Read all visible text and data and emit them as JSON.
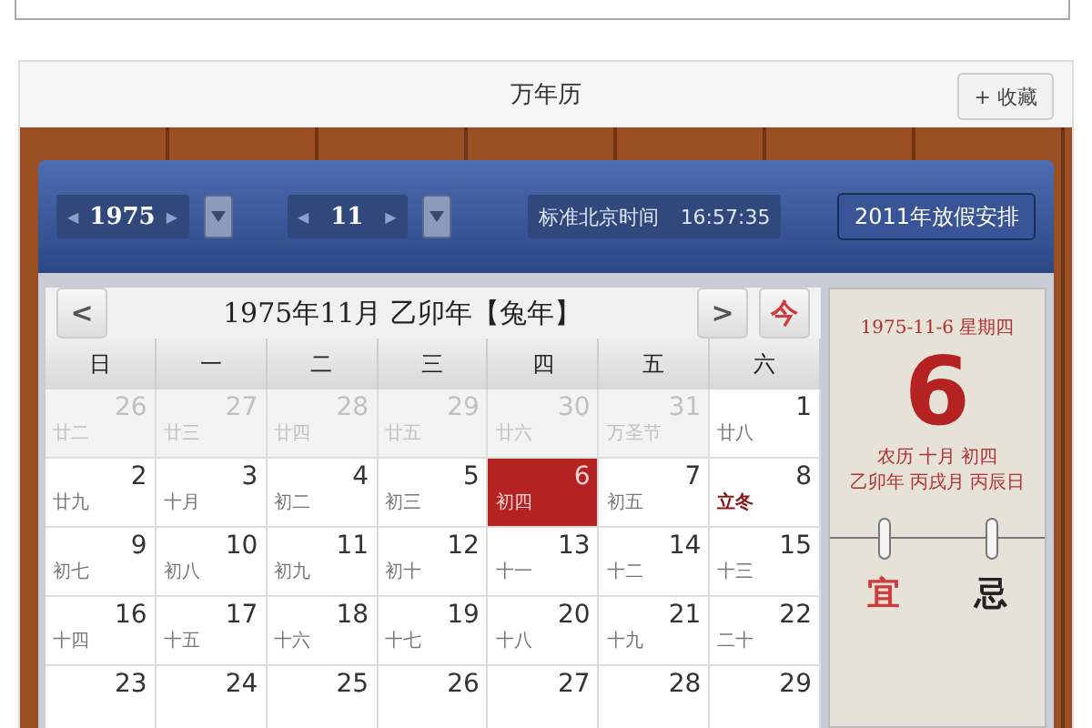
{
  "header": {
    "title": "万年历",
    "bookmark_button": "+ 收藏"
  },
  "toolbar": {
    "year": {
      "value": "1975",
      "prev": "◀",
      "next": "▶"
    },
    "month": {
      "value": "11",
      "prev": "◀",
      "next": "▶"
    },
    "clock_label": "标准北京时间",
    "clock_time": "16:57:35",
    "holiday_button": "2011年放假安排"
  },
  "calendar": {
    "prev_button": "<",
    "next_button": ">",
    "today_button": "今",
    "month_title": "1975年11月 乙卯年【兔年】",
    "weekdays": [
      "日",
      "一",
      "二",
      "三",
      "四",
      "五",
      "六"
    ],
    "weeks": [
      [
        {
          "day": "26",
          "lunar": "廿二",
          "kind": "other",
          "selected": false
        },
        {
          "day": "27",
          "lunar": "廿三",
          "kind": "other",
          "selected": false
        },
        {
          "day": "28",
          "lunar": "廿四",
          "kind": "other",
          "selected": false
        },
        {
          "day": "29",
          "lunar": "廿五",
          "kind": "other",
          "selected": false
        },
        {
          "day": "30",
          "lunar": "廿六",
          "kind": "other",
          "selected": false
        },
        {
          "day": "31",
          "lunar": "万圣节",
          "kind": "other",
          "selected": false
        },
        {
          "day": "1",
          "lunar": "廿八",
          "kind": "normal",
          "selected": false
        }
      ],
      [
        {
          "day": "2",
          "lunar": "廿九",
          "kind": "normal",
          "selected": false
        },
        {
          "day": "3",
          "lunar": "十月",
          "kind": "normal",
          "selected": false
        },
        {
          "day": "4",
          "lunar": "初二",
          "kind": "normal",
          "selected": false
        },
        {
          "day": "5",
          "lunar": "初三",
          "kind": "normal",
          "selected": false
        },
        {
          "day": "6",
          "lunar": "初四",
          "kind": "normal",
          "selected": true
        },
        {
          "day": "7",
          "lunar": "初五",
          "kind": "normal",
          "selected": false
        },
        {
          "day": "8",
          "lunar": "立冬",
          "kind": "term",
          "selected": false
        }
      ],
      [
        {
          "day": "9",
          "lunar": "初七",
          "kind": "normal",
          "selected": false
        },
        {
          "day": "10",
          "lunar": "初八",
          "kind": "normal",
          "selected": false
        },
        {
          "day": "11",
          "lunar": "初九",
          "kind": "normal",
          "selected": false
        },
        {
          "day": "12",
          "lunar": "初十",
          "kind": "normal",
          "selected": false
        },
        {
          "day": "13",
          "lunar": "十一",
          "kind": "normal",
          "selected": false
        },
        {
          "day": "14",
          "lunar": "十二",
          "kind": "normal",
          "selected": false
        },
        {
          "day": "15",
          "lunar": "十三",
          "kind": "normal",
          "selected": false
        }
      ],
      [
        {
          "day": "16",
          "lunar": "十四",
          "kind": "normal",
          "selected": false
        },
        {
          "day": "17",
          "lunar": "十五",
          "kind": "normal",
          "selected": false
        },
        {
          "day": "18",
          "lunar": "十六",
          "kind": "normal",
          "selected": false
        },
        {
          "day": "19",
          "lunar": "十七",
          "kind": "normal",
          "selected": false
        },
        {
          "day": "20",
          "lunar": "十八",
          "kind": "normal",
          "selected": false
        },
        {
          "day": "21",
          "lunar": "十九",
          "kind": "normal",
          "selected": false
        },
        {
          "day": "22",
          "lunar": "二十",
          "kind": "normal",
          "selected": false
        }
      ],
      [
        {
          "day": "23",
          "kind": "normal",
          "selected": false
        },
        {
          "day": "24",
          "kind": "normal",
          "selected": false
        },
        {
          "day": "25",
          "kind": "normal",
          "selected": false
        },
        {
          "day": "26",
          "kind": "normal",
          "selected": false
        },
        {
          "day": "27",
          "kind": "normal",
          "selected": false
        },
        {
          "day": "28",
          "kind": "normal",
          "selected": false
        },
        {
          "day": "29",
          "kind": "normal",
          "selected": false
        }
      ]
    ]
  },
  "day_card": {
    "date": "1975-11-6 星期四",
    "day": "6",
    "lunar_date": "农历 十月 初四",
    "ganzhi": "乙卯年 丙戌月 丙辰日",
    "good_label": "宜",
    "bad_label": "忌"
  }
}
